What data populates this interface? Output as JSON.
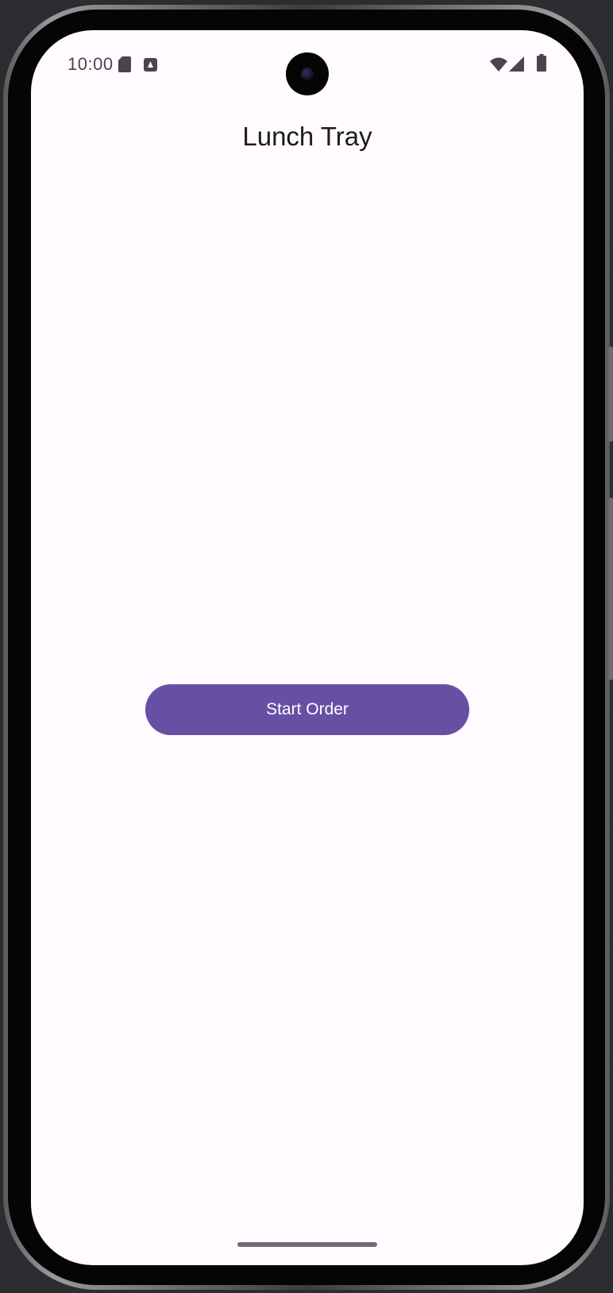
{
  "status_bar": {
    "time": "10:00",
    "left_icons": [
      "sd-card-icon",
      "notification-icon"
    ],
    "right_icons": [
      "wifi-icon",
      "cell-signal-icon",
      "battery-icon"
    ]
  },
  "app": {
    "title": "Lunch Tray",
    "start_button_label": "Start Order",
    "accent_color": "#6750a4",
    "background_color": "#fffbfe"
  }
}
